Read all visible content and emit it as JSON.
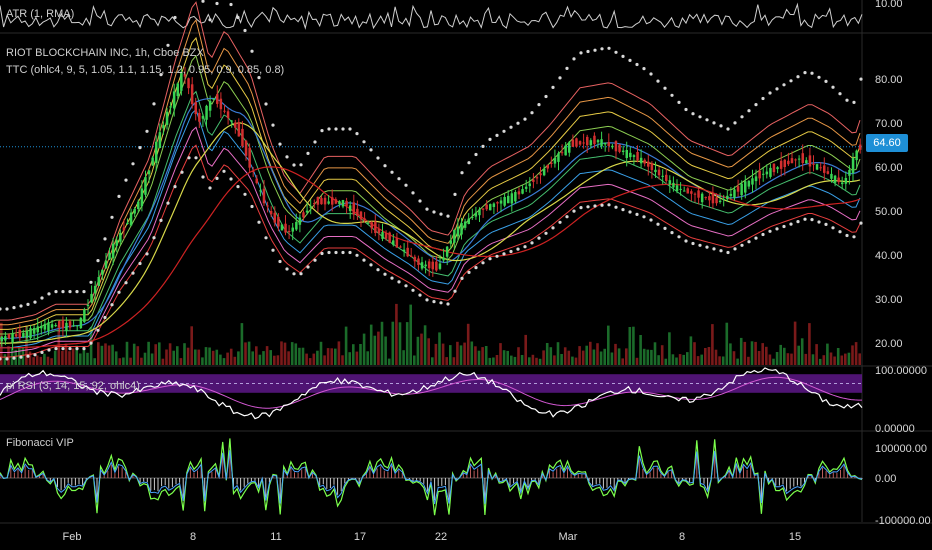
{
  "atr_panel": {
    "title": "ATR (1, RMA)",
    "tick": "10.00"
  },
  "main_panel": {
    "symbol_line": "RIOT BLOCKCHAIN INC, 1h, Cboe BZX",
    "indicator_line": "TTC (ohlc4, 9, 5, 1.05, 1.1, 1.15, 1.2, 0.95, 0.9, 0.85, 0.8)",
    "last_price": "64.60",
    "price_ticks": [
      "80.00",
      "70.00",
      "60.00",
      "50.00",
      "40.00",
      "30.00",
      "20.00"
    ]
  },
  "rsi_panel": {
    "title": "pi RSI (3, 14, 15, 92, ohlc4)",
    "ticks": [
      "100.00000",
      "0.00000"
    ]
  },
  "fib_panel": {
    "title": "Fibonacci VIP",
    "ticks": [
      "100000.00",
      "0.00",
      "-100000.00"
    ]
  },
  "time_axis": {
    "labels": [
      "Feb",
      "8",
      "11",
      "17",
      "22",
      "Mar",
      "8",
      "15"
    ]
  },
  "colors": {
    "background": "#000000",
    "up": "#26a69a",
    "down": "#c62828",
    "price_tag": "#1e8fd6",
    "rsi_band": "#6a1b9a",
    "fib_line": "#7cff4c"
  },
  "chart_data": [
    {
      "type": "line",
      "title": "RIOT BLOCKCHAIN INC, 1h, Cboe BZX",
      "x": [
        "Feb",
        "8",
        "11",
        "17",
        "22",
        "Mar",
        "8",
        "15"
      ],
      "series": [
        {
          "name": "price",
          "values": [
            21,
            24,
            40,
            52,
            80,
            68,
            55,
            45,
            52,
            42,
            36,
            58,
            65,
            64.6
          ]
        }
      ],
      "ylim": [
        15,
        90
      ]
    },
    {
      "type": "line",
      "title": "pi RSI (3, 14, 15, 92, ohlc4)",
      "ylim": [
        0,
        100
      ]
    },
    {
      "type": "bar",
      "title": "Fibonacci VIP",
      "ylim": [
        -100000,
        100000
      ]
    }
  ]
}
